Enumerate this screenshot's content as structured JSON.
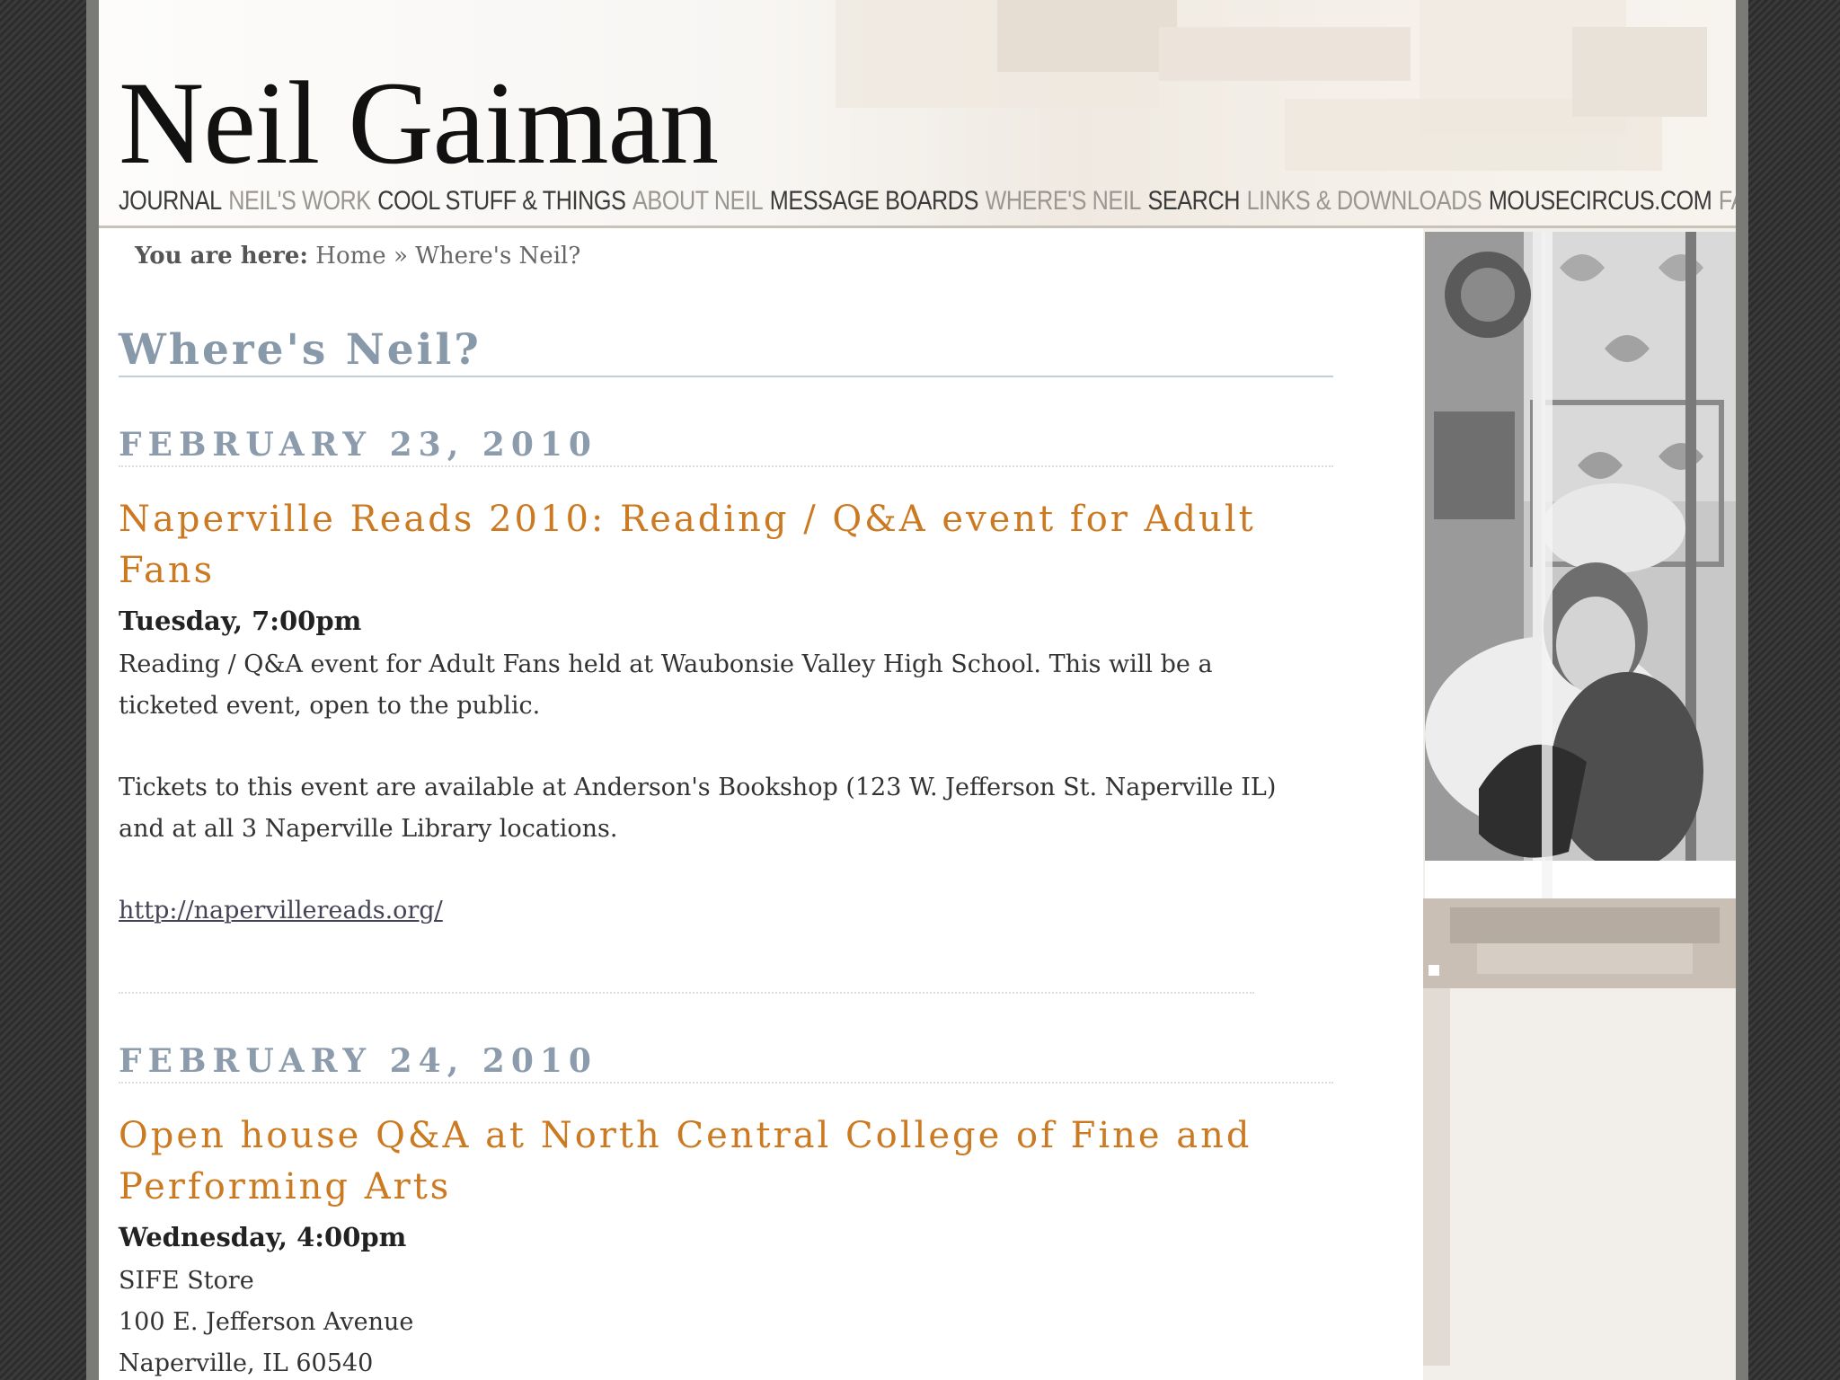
{
  "site": {
    "title": "Neil Gaiman"
  },
  "nav": {
    "items": [
      {
        "label": "JOURNAL"
      },
      {
        "label": "NEIL'S WORK"
      },
      {
        "label": "COOL STUFF & THINGS"
      },
      {
        "label": "ABOUT NEIL"
      },
      {
        "label": "MESSAGE BOARDS"
      },
      {
        "label": "WHERE'S NEIL"
      },
      {
        "label": "SEARCH"
      },
      {
        "label": "LINKS & DOWNLOADS"
      },
      {
        "label": "MOUSECIRCUS.COM"
      },
      {
        "label": "FAQs"
      }
    ]
  },
  "breadcrumb": {
    "prefix": "You are here:",
    "home": "Home",
    "separator": "»",
    "current": "Where's Neil?"
  },
  "page": {
    "title": "Where's Neil?"
  },
  "events": [
    {
      "date": "FEBRUARY 23, 2010",
      "title": "Naperville Reads 2010: Reading / Q&A event for Adult Fans",
      "time": "Tuesday, 7:00pm",
      "description": "Reading / Q&A event for Adult Fans held at Waubonsie Valley High School. This will be a ticketed event, open to the public.",
      "tickets": "Tickets to this event are available at Anderson's Bookshop (123 W. Jefferson St. Naperville IL) and at all 3 Naperville Library locations.",
      "link": "http://napervillereads.org/"
    },
    {
      "date": "FEBRUARY 24, 2010",
      "title": "Open house Q&A at North Central College of Fine and Performing Arts",
      "time": "Wednesday, 4:00pm",
      "address": [
        "SIFE Store",
        "100 E. Jefferson Avenue",
        "Naperville, IL 60540"
      ]
    }
  ],
  "colors": {
    "nav_dark": "#3a3a3a",
    "nav_light": "#9a9690",
    "heading_blue": "#8899aa",
    "event_orange": "#cc7a22"
  }
}
